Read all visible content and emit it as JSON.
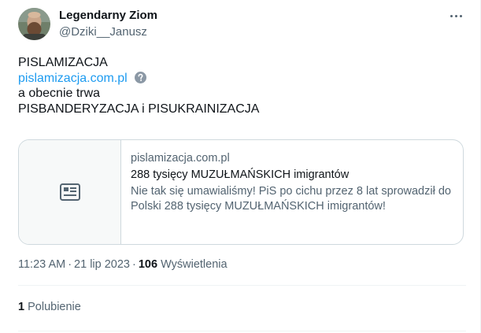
{
  "author": {
    "display_name": "Legendarny Ziom",
    "handle": "@Dziki__Janusz"
  },
  "tweet": {
    "line1": "PISLAMIZACJA",
    "link_text": "pislamizacja.com.pl",
    "line3": "a obecnie trwa",
    "line4": "PISBANDERYZACJA i PISUKRAINIZACJA"
  },
  "card": {
    "domain": "pislamizacja.com.pl",
    "title": "288 tysięcy MUZUŁMAŃSKICH imigrantów",
    "description": "Nie tak się umawialiśmy! PiS po cichu przez 8 lat sprowadził do Polski 288 tysięcy MUZUŁMAŃSKICH imigrantów!"
  },
  "meta": {
    "time": "11:23 AM",
    "separator": "·",
    "date": "21 lip 2023",
    "views_count": "106",
    "views_label": "Wyświetlenia"
  },
  "engagement": {
    "likes_count": "1",
    "likes_label": "Polubienie"
  },
  "colors": {
    "link": "#1d9bf0",
    "secondary_text": "#536471",
    "primary_text": "#0f1419",
    "border": "#cfd9de"
  }
}
